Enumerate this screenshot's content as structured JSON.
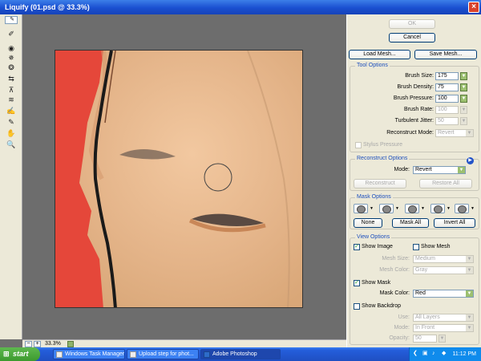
{
  "window": {
    "title": "Liquify (01.psd @ 33.3%)",
    "close": "×"
  },
  "tools": [
    {
      "name": "forward-warp-tool-icon",
      "glyph": "✎",
      "selected": true
    },
    {
      "name": "reconstruct-tool-icon",
      "glyph": "✐"
    },
    {
      "name": "twirl-clockwise-tool-icon",
      "glyph": "◉"
    },
    {
      "name": "pucker-tool-icon",
      "glyph": "✵"
    },
    {
      "name": "bloat-tool-icon",
      "glyph": "❂"
    },
    {
      "name": "push-left-tool-icon",
      "glyph": "⇆"
    },
    {
      "name": "mirror-tool-icon",
      "glyph": "⊼"
    },
    {
      "name": "turbulence-tool-icon",
      "glyph": "≋"
    },
    {
      "name": "freeze-mask-tool-icon",
      "glyph": "✍"
    },
    {
      "name": "thaw-mask-tool-icon",
      "glyph": "✎"
    },
    {
      "name": "hand-tool-icon",
      "glyph": "✋"
    },
    {
      "name": "zoom-tool-icon",
      "glyph": "🔍"
    }
  ],
  "status": {
    "zoom": "33.3%",
    "minus": "−",
    "plus": "+"
  },
  "buttons": {
    "ok": "OK",
    "cancel": "Cancel",
    "load_mesh": "Load Mesh...",
    "save_mesh": "Save Mesh..."
  },
  "tool_options": {
    "title": "Tool Options",
    "brush_size": {
      "label": "Brush Size:",
      "value": "175"
    },
    "brush_density": {
      "label": "Brush Density:",
      "value": "75"
    },
    "brush_pressure": {
      "label": "Brush Pressure:",
      "value": "100"
    },
    "brush_rate": {
      "label": "Brush Rate:",
      "value": "100"
    },
    "turbulent_jitter": {
      "label": "Turbulent Jitter:",
      "value": "50"
    },
    "reconstruct_mode": {
      "label": "Reconstruct Mode:",
      "value": "Revert"
    },
    "stylus_pressure": "Stylus Pressure"
  },
  "reconstruct_options": {
    "title": "Reconstruct Options",
    "mode_label": "Mode:",
    "mode_value": "Revert",
    "reconstruct": "Reconstruct",
    "restore_all": "Restore All"
  },
  "mask_options": {
    "title": "Mask Options",
    "none": "None",
    "mask_all": "Mask All",
    "invert_all": "Invert All"
  },
  "view_options": {
    "title": "View Options",
    "show_image": "Show Image",
    "show_mesh": "Show Mesh",
    "mesh_size": {
      "label": "Mesh Size:",
      "value": "Medium"
    },
    "mesh_color": {
      "label": "Mesh Color:",
      "value": "Gray"
    },
    "show_mask": "Show Mask",
    "mask_color": {
      "label": "Mask Color:",
      "value": "Red"
    },
    "show_backdrop": "Show Backdrop",
    "use": {
      "label": "Use:",
      "value": "All Layers"
    },
    "mode": {
      "label": "Mode:",
      "value": "In Front"
    },
    "opacity": {
      "label": "Opacity:",
      "value": "50"
    }
  },
  "taskbar": {
    "start": "start",
    "tasks": [
      "Windows Task Manager",
      "Upload step for phot...",
      "Adobe Photoshop"
    ],
    "clock": "11:12 PM"
  },
  "colors": {
    "mask_red": "#e5473a",
    "skin": "#e5b890",
    "crack": "#1a1a1a",
    "accent": "#1c4fbd"
  }
}
